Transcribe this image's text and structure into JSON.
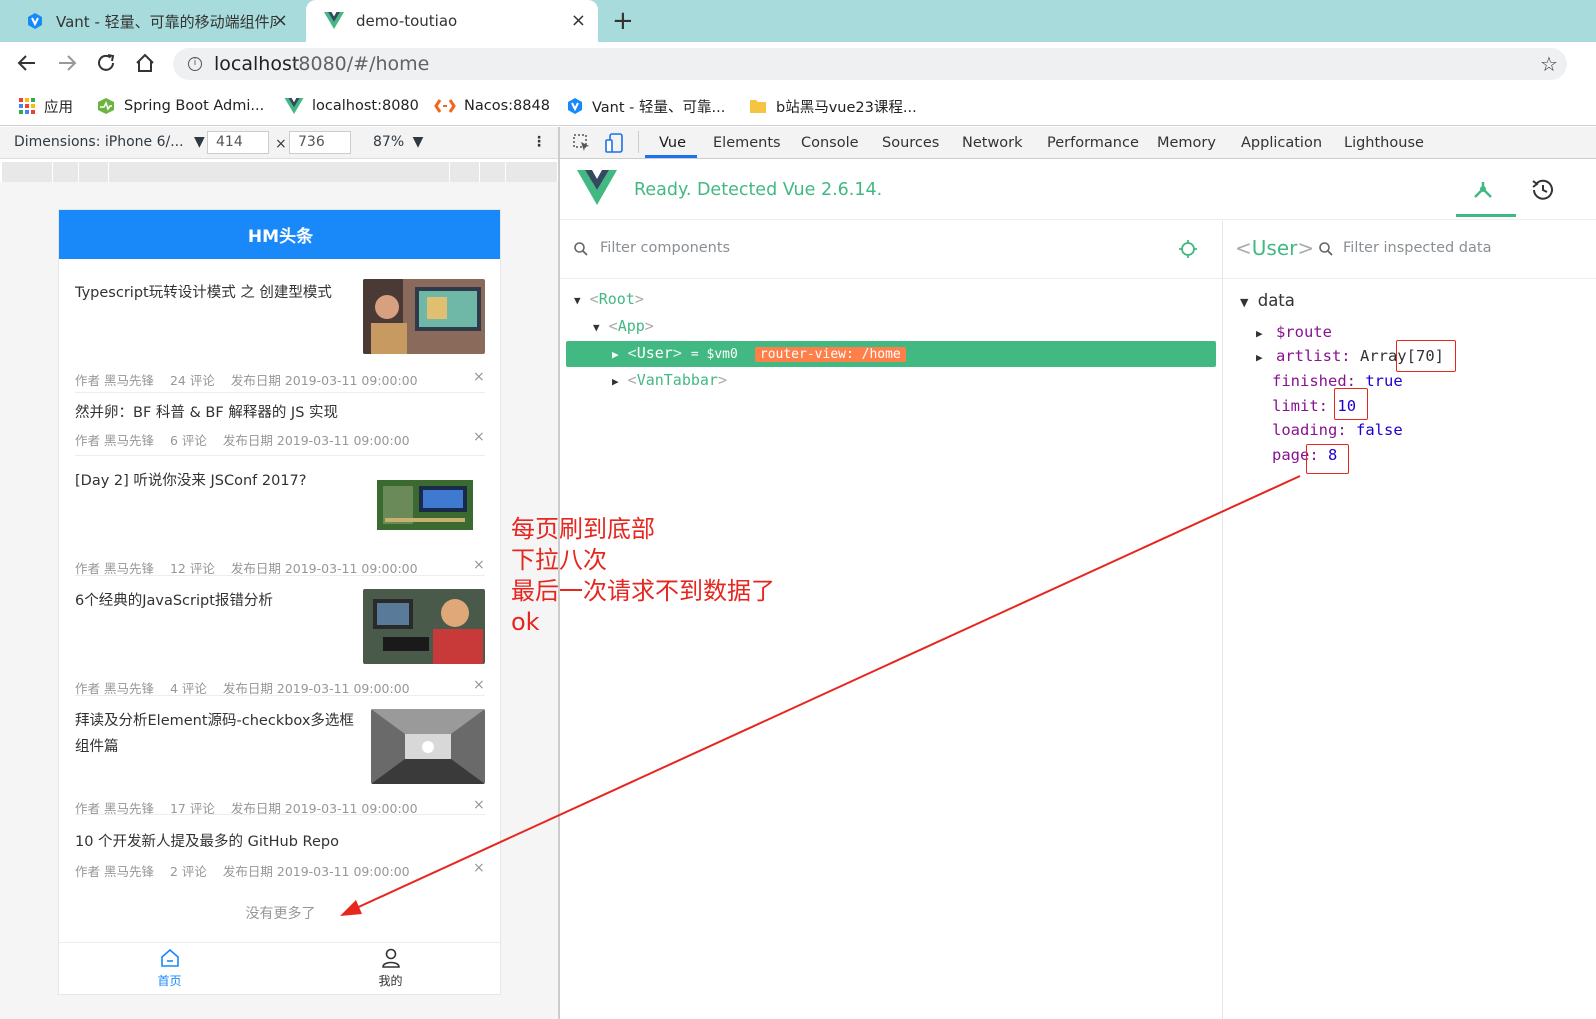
{
  "browser": {
    "tabs": [
      {
        "title": "Vant - 轻量、可靠的移动端组件库",
        "close": "×"
      },
      {
        "title": "demo-toutiao",
        "close": "×"
      }
    ],
    "new_tab": "+",
    "url_host": "localhost",
    "url_path": ":8080/#/home",
    "bookmarks": [
      {
        "label": "应用",
        "icon": "apps-grid-icon"
      },
      {
        "label": "Spring Boot Admi...",
        "icon": "spring-admin-icon"
      },
      {
        "label": "localhost:8080",
        "icon": "vue-icon"
      },
      {
        "label": "Nacos:8848",
        "icon": "nacos-icon"
      },
      {
        "label": "Vant - 轻量、可靠...",
        "icon": "vant-icon"
      },
      {
        "label": "b站黑马vue23课程...",
        "icon": "folder-icon"
      }
    ]
  },
  "device_toolbar": {
    "dimensions": "Dimensions: iPhone 6/...",
    "width": "414",
    "times": "×",
    "height": "736",
    "zoom": "87%"
  },
  "phone": {
    "nav_title": "HM头条",
    "articles": [
      {
        "title": "Typescript玩转设计模式 之 创建型模式",
        "author": "作者 黑马先锋",
        "comments": "24 评论",
        "date": "发布日期 2019-03-11 09:00:00",
        "has_image": true
      },
      {
        "title": "然并卵：BF 科普 & BF 解释器的 JS 实现",
        "author": "作者 黑马先锋",
        "comments": "6 评论",
        "date": "发布日期 2019-03-11 09:00:00",
        "has_image": false
      },
      {
        "title": "[Day 2] 听说你没来 JSConf 2017?",
        "author": "作者 黑马先锋",
        "comments": "12 评论",
        "date": "发布日期 2019-03-11 09:00:00",
        "has_image": true
      },
      {
        "title": "6个经典的JavaScript报错分析",
        "author": "作者 黑马先锋",
        "comments": "4 评论",
        "date": "发布日期 2019-03-11 09:00:00",
        "has_image": true
      },
      {
        "title": "拜读及分析Element源码-checkbox多选框组件篇",
        "author": "作者 黑马先锋",
        "comments": "17 评论",
        "date": "发布日期 2019-03-11 09:00:00",
        "has_image": true
      },
      {
        "title": "10 个开发新人提及最多的 GitHub Repo",
        "author": "作者 黑马先锋",
        "comments": "2 评论",
        "date": "发布日期 2019-03-11 09:00:00",
        "has_image": false
      }
    ],
    "close_glyph": "×",
    "no_more": "没有更多了",
    "tabbar": [
      {
        "label": "首页",
        "icon": "home-icon",
        "active": true
      },
      {
        "label": "我的",
        "icon": "user-icon",
        "active": false
      }
    ]
  },
  "annotation": {
    "lines": [
      "每页刷到底部",
      "下拉八次",
      "最后一次请求不到数据了",
      "ok"
    ],
    "color": "#e6261f"
  },
  "devtools": {
    "tabs": [
      "Vue",
      "Elements",
      "Console",
      "Sources",
      "Network",
      "Performance",
      "Memory",
      "Application",
      "Lighthouse"
    ],
    "active_tab": "Vue",
    "vue_status": "Ready. Detected Vue 2.6.14.",
    "filter_components": "Filter components",
    "inspected_component": "User",
    "filter_inspected": "Filter inspected data",
    "tree": {
      "root": "Root",
      "app": "App",
      "user": "User",
      "user_suffix": "= $vm0",
      "router_badge": "router-view: /home",
      "tabbar": "VanTabbar"
    },
    "data_section": "data",
    "data": {
      "route_key": "$route",
      "artlist_key": "artlist",
      "artlist_type": "Array",
      "artlist_len": "[70]",
      "finished_key": "finished",
      "finished_val": "true",
      "limit_key": "limit",
      "limit_val": "10",
      "loading_key": "loading",
      "loading_val": "false",
      "page_key": "page",
      "page_val": "8"
    },
    "accent_color": "#42b983"
  }
}
